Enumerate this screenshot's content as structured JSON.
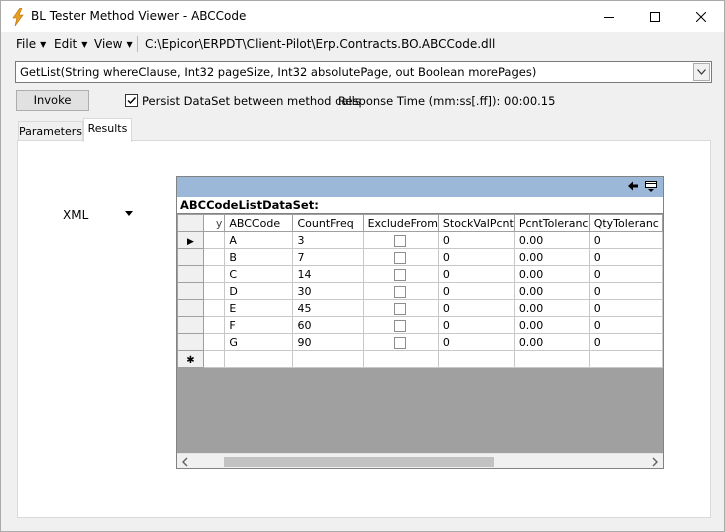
{
  "window": {
    "title": "BL Tester Method Viewer - ABCCode"
  },
  "menu": {
    "file": "File",
    "edit": "Edit",
    "view": "View",
    "path": "C:\\Epicor\\ERPDT\\Client-Pilot\\Erp.Contracts.BO.ABCCode.dll"
  },
  "method": {
    "selected": "GetList(String whereClause, Int32 pageSize, Int32 absolutePage, out Boolean morePages)"
  },
  "toolbar": {
    "invoke_label": "Invoke",
    "persist_label": "Persist DataSet between method calls",
    "persist_checked": true,
    "response_time": "Response Time (mm:ss[.ff]): 00:00.15"
  },
  "tabs": [
    {
      "label": "Parameters",
      "active": false
    },
    {
      "label": "Results",
      "active": true
    }
  ],
  "results": {
    "format": "XML"
  },
  "grid": {
    "dataset_title": "ABCCodeListDataSet:",
    "columns": [
      "y",
      "ABCCode",
      "CountFreq",
      "ExcludeFrom",
      "StockValPcnt",
      "PcntToleranc",
      "QtyToleranc"
    ],
    "rows": [
      {
        "ABCCode": "A",
        "CountFreq": "3",
        "ExcludeFrom": false,
        "StockValPcnt": "0",
        "PcntToleranc": "0.00",
        "QtyToleranc": "0"
      },
      {
        "ABCCode": "B",
        "CountFreq": "7",
        "ExcludeFrom": false,
        "StockValPcnt": "0",
        "PcntToleranc": "0.00",
        "QtyToleranc": "0"
      },
      {
        "ABCCode": "C",
        "CountFreq": "14",
        "ExcludeFrom": false,
        "StockValPcnt": "0",
        "PcntToleranc": "0.00",
        "QtyToleranc": "0"
      },
      {
        "ABCCode": "D",
        "CountFreq": "30",
        "ExcludeFrom": false,
        "StockValPcnt": "0",
        "PcntToleranc": "0.00",
        "QtyToleranc": "0"
      },
      {
        "ABCCode": "E",
        "CountFreq": "45",
        "ExcludeFrom": false,
        "StockValPcnt": "0",
        "PcntToleranc": "0.00",
        "QtyToleranc": "0"
      },
      {
        "ABCCode": "F",
        "CountFreq": "60",
        "ExcludeFrom": false,
        "StockValPcnt": "0",
        "PcntToleranc": "0.00",
        "QtyToleranc": "0"
      },
      {
        "ABCCode": "G",
        "CountFreq": "90",
        "ExcludeFrom": false,
        "StockValPcnt": "0",
        "PcntToleranc": "0.00",
        "QtyToleranc": "0"
      }
    ],
    "current_row_glyph": "▶",
    "new_row_glyph": "✱"
  },
  "icons": {
    "app": "lightning-icon",
    "back": "arrow-left-icon",
    "caption_options": "grid-options-icon"
  },
  "colors": {
    "caption_bar": "#9bb8d8",
    "grid_background": "#a0a0a0",
    "app_icon": "#e8a020"
  }
}
